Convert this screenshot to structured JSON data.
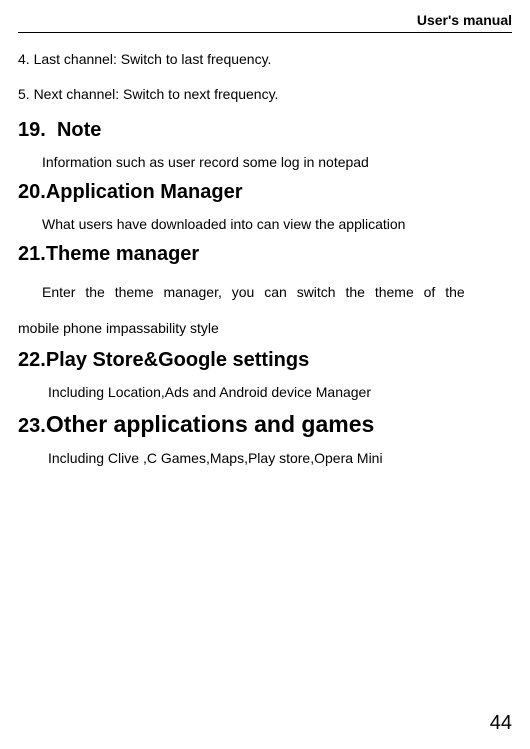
{
  "header": {
    "title": "User's manual"
  },
  "lines": {
    "line4": "4. Last channel: Switch to last frequency.",
    "line5": "5. Next channel: Switch to next frequency."
  },
  "sections": {
    "s19": {
      "num": "19.",
      "title": "Note",
      "desc": "Information such as user record some log in notepad"
    },
    "s20": {
      "num": "20.",
      "title": "Application Manager",
      "desc": "What users have downloaded into can view the application"
    },
    "s21": {
      "num": "21.",
      "title": "Theme manager",
      "desc_line1": "Enter the theme manager, you can switch the theme of the",
      "desc_line2": "mobile phone impassability style"
    },
    "s22": {
      "num": "22.",
      "title": "Play Store&Google settings",
      "desc": "Including Location,Ads and Android device Manager"
    },
    "s23": {
      "num": "23.",
      "title": "Other applications and games",
      "desc": "Including Clive ,C Games,Maps,Play store,Opera Mini"
    }
  },
  "page_number": "44"
}
